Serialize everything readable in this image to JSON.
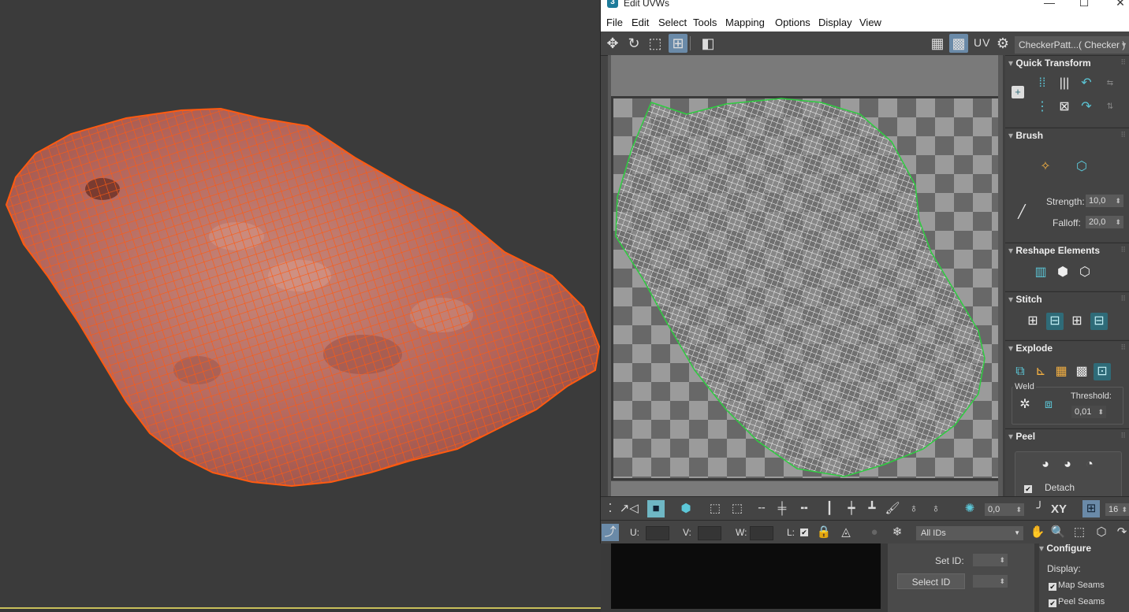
{
  "window": {
    "title": "Edit UVWs",
    "app_icon": "3ds-max-icon",
    "controls": {
      "minimize": "—",
      "maximize": "☐",
      "close": "✕"
    }
  },
  "menu": [
    "File",
    "Edit",
    "Select",
    "Tools",
    "Mapping",
    "Options",
    "Display",
    "View"
  ],
  "toolbar": {
    "uv_label": "UV",
    "map_dropdown": "CheckerPatt...( Checker )"
  },
  "panels": {
    "quick_transform": {
      "title": "Quick Transform"
    },
    "brush": {
      "title": "Brush",
      "strength_label": "Strength:",
      "strength_value": "10,0",
      "falloff_label": "Falloff:",
      "falloff_value": "20,0"
    },
    "reshape": {
      "title": "Reshape Elements"
    },
    "stitch": {
      "title": "Stitch"
    },
    "explode": {
      "title": "Explode",
      "weld_label": "Weld",
      "threshold_label": "Threshold:",
      "threshold_value": "0,01"
    },
    "peel": {
      "title": "Peel",
      "detach_label": "Detach",
      "detach_checked": true
    }
  },
  "status1": {
    "angle_value": "0,0",
    "xy_label": "XY",
    "grid_value": "16"
  },
  "status2": {
    "u_label": "U:",
    "v_label": "V:",
    "w_label": "W:",
    "l_label": "L:",
    "ids_dropdown": "All IDs"
  },
  "id_panel": {
    "set_id_label": "Set ID:",
    "select_id_label": "Select ID"
  },
  "configure": {
    "title": "Configure",
    "display_label": "Display:",
    "map_seams": "Map Seams",
    "peel_seams": "Peel Seams"
  },
  "colors": {
    "mesh_wire": "#ff5a10",
    "mesh_fill": "#b86a5a",
    "uv_wire": "#ffffff",
    "uv_border": "#2ecc40",
    "accent": "#6fb7c4"
  }
}
